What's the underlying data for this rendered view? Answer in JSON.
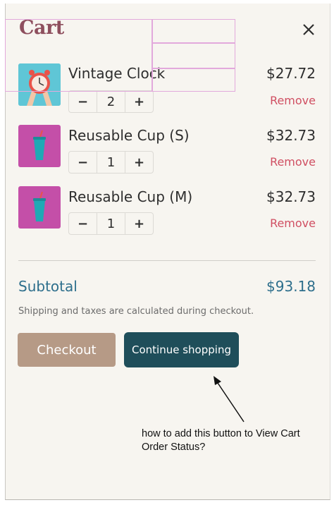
{
  "cart": {
    "title": "Cart",
    "close_icon": "close-icon",
    "items": [
      {
        "name": "Vintage Clock",
        "price": "$27.72",
        "quantity": "2",
        "remove_label": "Remove",
        "image": "clock-image"
      },
      {
        "name": "Reusable Cup (S)",
        "price": "$32.73",
        "quantity": "1",
        "remove_label": "Remove",
        "image": "cup-image"
      },
      {
        "name": "Reusable Cup (M)",
        "price": "$32.73",
        "quantity": "1",
        "remove_label": "Remove",
        "image": "cup-image"
      }
    ],
    "decrement_symbol": "−",
    "increment_symbol": "+",
    "subtotal_label": "Subtotal",
    "subtotal_value": "$93.18",
    "shipping_note": "Shipping and taxes are calculated during checkout.",
    "checkout_label": "Checkout",
    "continue_label": "Continue shopping"
  },
  "annotation": {
    "line1": "how to add this button to View Cart",
    "line2": "Order Status?"
  },
  "colors": {
    "title": "#8e4f5e",
    "remove": "#d04f62",
    "subtotal": "#2e6f8c",
    "checkout_bg": "#b69a86",
    "continue_bg": "#1f4e5a",
    "panel_bg": "#f7f5f0"
  }
}
